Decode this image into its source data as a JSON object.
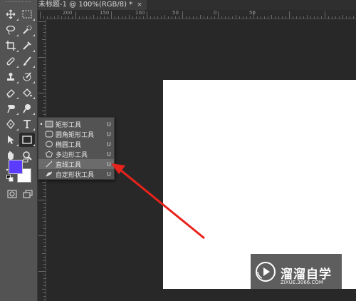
{
  "document_tab": {
    "title": "未标题-1 @ 100%(RGB/8) *",
    "close": "×"
  },
  "ruler": {
    "labels": [
      "200",
      "150",
      "100",
      "50",
      "0",
      "50"
    ]
  },
  "tools": {
    "foreground_color": "#5b3cff",
    "background_color": "#ffffff"
  },
  "flyout": {
    "items": [
      {
        "label": "矩形工具",
        "key": "U",
        "icon": "rectangle-icon",
        "selected_bullet": "•"
      },
      {
        "label": "圆角矩形工具",
        "key": "U",
        "icon": "rounded-rectangle-icon",
        "selected_bullet": ""
      },
      {
        "label": "椭圆工具",
        "key": "U",
        "icon": "ellipse-icon",
        "selected_bullet": ""
      },
      {
        "label": "多边形工具",
        "key": "U",
        "icon": "polygon-icon",
        "selected_bullet": ""
      },
      {
        "label": "直线工具",
        "key": "U",
        "icon": "line-icon",
        "selected_bullet": ""
      },
      {
        "label": "自定形状工具",
        "key": "U",
        "icon": "custom-shape-icon",
        "selected_bullet": ""
      }
    ]
  },
  "watermark": {
    "text": "溜溜自学",
    "url": "ZIXUE.3066.COM"
  },
  "colors": {
    "annotation_arrow": "#e8231c",
    "canvas": "#ffffff",
    "workspace": "#282828"
  }
}
